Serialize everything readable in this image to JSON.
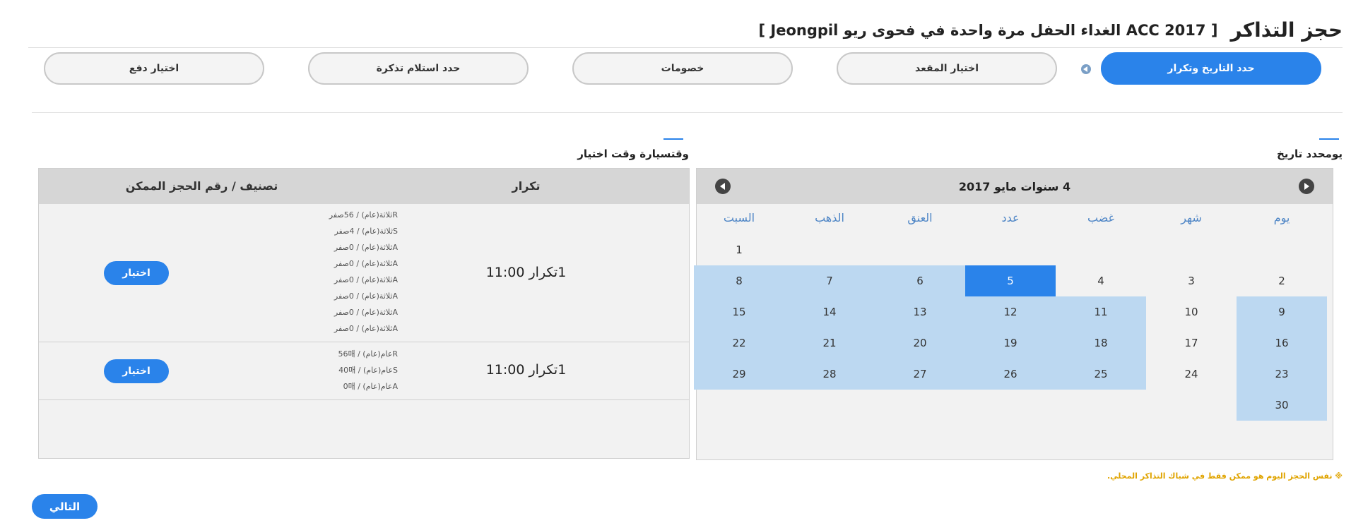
{
  "header": {
    "title": "حجز التذاكر",
    "subtitle": "[ ACC 2017 الغداء الحفل مرة واحدة في فحوى ريو Jeongpil ]"
  },
  "steps": [
    {
      "label": "حدد التاريخ وتكرار",
      "active": true
    },
    {
      "label": "اختيار المقعد",
      "active": false
    },
    {
      "label": "خصومات",
      "active": false
    },
    {
      "label": "حدد استلام تذكرة",
      "active": false
    },
    {
      "label": "اختيار دفع",
      "active": false
    }
  ],
  "date_section": {
    "label": "يومحدد تاريخ",
    "month_title": "4 سنوات مايو 2017",
    "weekdays": [
      "يوم",
      "شهر",
      "غضب",
      "عدد",
      "العنق",
      "الذهب",
      "السبت"
    ],
    "weeks": [
      [
        "",
        "",
        "",
        "",
        "",
        "",
        "1"
      ],
      [
        "2",
        "3",
        "4",
        "5",
        "6",
        "7",
        "8"
      ],
      [
        "9",
        "10",
        "11",
        "12",
        "13",
        "14",
        "15"
      ],
      [
        "16",
        "17",
        "18",
        "19",
        "20",
        "21",
        "22"
      ],
      [
        "23",
        "24",
        "25",
        "26",
        "27",
        "28",
        "29"
      ],
      [
        "30",
        "",
        "",
        "",
        "",
        "",
        ""
      ]
    ],
    "available_days": [
      "5",
      "6",
      "7",
      "8",
      "9",
      "11",
      "12",
      "13",
      "14",
      "15",
      "16",
      "18",
      "19",
      "20",
      "21",
      "22",
      "23",
      "25",
      "26",
      "27",
      "28",
      "29",
      "30"
    ],
    "selected_day": "5"
  },
  "time_section": {
    "label": "وقتسيارة وقت اختيار",
    "col_round": "تكرار",
    "col_seats": "تصنيف / رقم الحجز الممكن",
    "rows": [
      {
        "time": "1تكرار 11:00",
        "seats": [
          "Rثلاثة(عام) / 56صفر",
          "Sثلاثة(عام) / 4صفر",
          "Aثلاثة(عام) / 0صفر",
          "Aثلاثة(عام) / 0صفر",
          "Aثلاثة(عام) / 0صفر",
          "Aثلاثة(عام) / 0صفر",
          "Aثلاثة(عام) / 0صفر",
          "Aثلاثة(عام) / 0صفر"
        ],
        "button": "اختيار"
      },
      {
        "time": "1تكرار 11:00",
        "seats": [
          "Rعام(عام) / 56매",
          "Sعام(عام) / 40매",
          "Aعام(عام) / 0매"
        ],
        "button": "اختيار"
      }
    ]
  },
  "notice": "※ نفس الحجز اليوم هو ممكن فقط في شباك التذاكر المحلي.",
  "next_button": "التالي",
  "colors": {
    "accent": "#2a83ea",
    "available": "#bcd8f1",
    "notice": "#e0a400"
  }
}
